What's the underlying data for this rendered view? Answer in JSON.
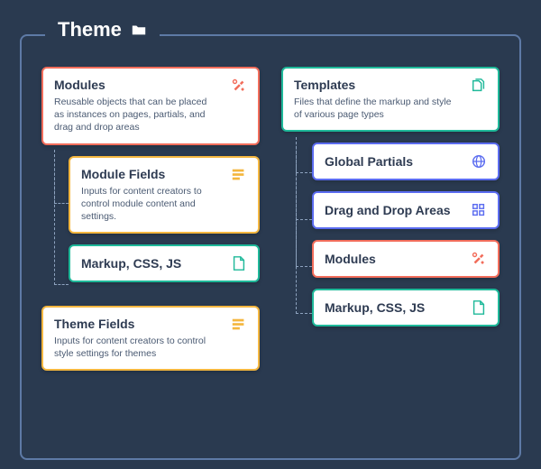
{
  "frame": {
    "title": "Theme",
    "icon": "folder-swap-icon"
  },
  "left": {
    "modules": {
      "title": "Modules",
      "desc": "Reusable objects that can be placed as instances on pages, partials, and drag and drop areas",
      "icon": "tools-icon",
      "color": "orange"
    },
    "module_fields": {
      "title": "Module Fields",
      "desc": "Inputs for content creators to control module content and settings.",
      "icon": "list-icon",
      "color": "amber"
    },
    "markup": {
      "title": "Markup, CSS, JS",
      "icon": "file-icon",
      "color": "teal"
    },
    "theme_fields": {
      "title": "Theme Fields",
      "desc": "Inputs for content creators to control style settings for themes",
      "icon": "list-icon",
      "color": "amber"
    }
  },
  "right": {
    "templates": {
      "title": "Templates",
      "desc": "Files that define the markup and style of various page types",
      "icon": "files-icon",
      "color": "teal"
    },
    "global_partials": {
      "title": "Global Partials",
      "icon": "globe-icon",
      "color": "indigo"
    },
    "drag_drop": {
      "title": "Drag and Drop Areas",
      "icon": "grid-icon",
      "color": "indigo"
    },
    "modules": {
      "title": "Modules",
      "icon": "tools-icon",
      "color": "orange"
    },
    "markup": {
      "title": "Markup, CSS, JS",
      "icon": "file-icon",
      "color": "teal"
    }
  }
}
